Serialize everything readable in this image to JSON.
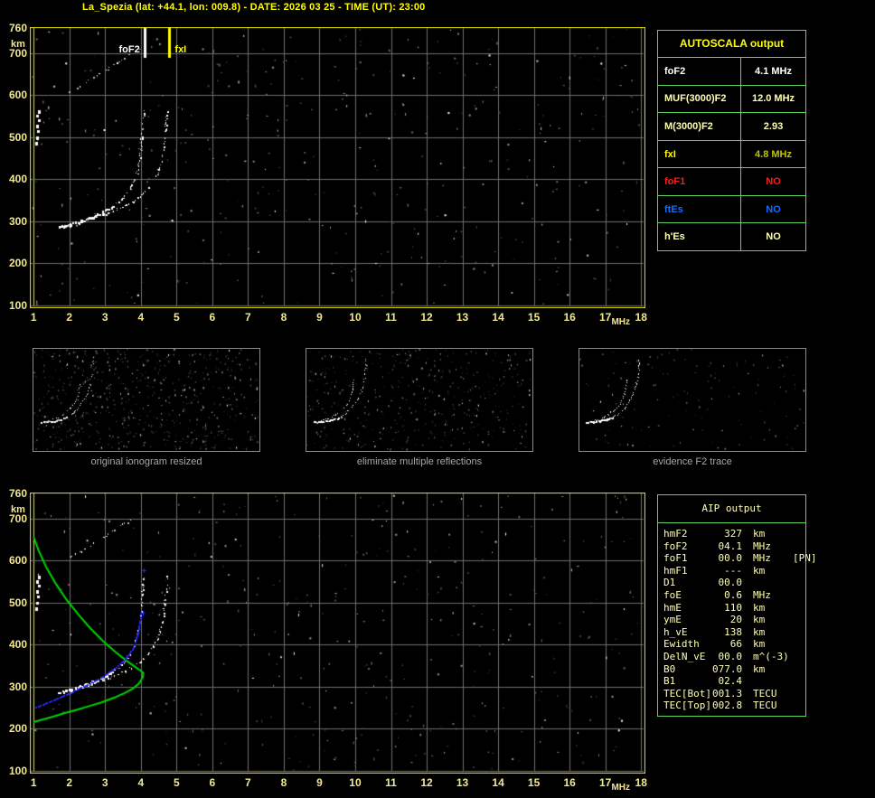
{
  "title": "La_Spezia (lat: +44.1, lon: 009.8) - DATE: 2026 03 25 - TIME (UT): 23:00",
  "palette": {
    "background": "#000000",
    "title_yellow": "#ffff00",
    "axis_label": "#f2e88e",
    "frame_yellow": "#e8e800",
    "grid_gray": "#6f6f6f",
    "table_border_green": "#5ed65e",
    "cream": "#ffffb0",
    "white": "#ffffff",
    "yellow": "#ffff00",
    "dark_yellow": "#c2c200",
    "red": "#ff1a1a",
    "blue": "#1a6aff",
    "caption_gray": "#a8a8a8",
    "profile_green": "#00d400",
    "trace_blue": "#2828ff"
  },
  "autoscala_table": {
    "title": "AUTOSCALA output",
    "rows": [
      {
        "label": "foF2",
        "value": "4.1 MHz",
        "label_color": "white",
        "value_color": "white"
      },
      {
        "label": "MUF(3000)F2",
        "value": "12.0 MHz",
        "label_color": "cream",
        "value_color": "cream"
      },
      {
        "label": "M(3000)F2",
        "value": "2.93",
        "label_color": "cream",
        "value_color": "cream"
      },
      {
        "label": "fxI",
        "value": "4.8 MHz",
        "label_color": "yellow",
        "value_color": "dark_yellow"
      },
      {
        "label": "foF1",
        "value": "NO",
        "label_color": "red",
        "value_color": "red"
      },
      {
        "label": "ftEs",
        "value": "NO",
        "label_color": "blue",
        "value_color": "blue"
      },
      {
        "label": "h'Es",
        "value": "NO",
        "label_color": "cream",
        "value_color": "cream"
      }
    ]
  },
  "aip_table": {
    "title": "AIP output",
    "rows": [
      {
        "label": "hmF2",
        "value": "327",
        "unit": "km",
        "note": ""
      },
      {
        "label": "foF2",
        "value": "04.1",
        "unit": "MHz",
        "note": ""
      },
      {
        "label": "foF1",
        "value": "00.0",
        "unit": "MHz",
        "note": "[PN]"
      },
      {
        "label": "hmF1",
        "value": "---",
        "unit": "km",
        "note": ""
      },
      {
        "label": "D1",
        "value": "00.0",
        "unit": "",
        "note": ""
      },
      {
        "label": "foE",
        "value": "0.6",
        "unit": "MHz",
        "note": ""
      },
      {
        "label": "hmE",
        "value": "110",
        "unit": "km",
        "note": ""
      },
      {
        "label": "ymE",
        "value": "20",
        "unit": "km",
        "note": ""
      },
      {
        "label": "h_vE",
        "value": "138",
        "unit": "km",
        "note": ""
      },
      {
        "label": "Ewidth",
        "value": "66",
        "unit": "km",
        "note": ""
      },
      {
        "label": "DelN_vE",
        "value": "00.0",
        "unit": "m^(-3)",
        "note": ""
      },
      {
        "label": "B0",
        "value": "077.0",
        "unit": "km",
        "note": ""
      },
      {
        "label": "B1",
        "value": "02.4",
        "unit": "",
        "note": ""
      },
      {
        "label": "TEC[Bot]",
        "value": "001.3",
        "unit": "TECU",
        "note": ""
      },
      {
        "label": "TEC[Top]",
        "value": "002.8",
        "unit": "TECU",
        "note": ""
      }
    ]
  },
  "thumbnails": [
    {
      "caption": "original ionogram resized"
    },
    {
      "caption": "eliminate multiple reflections"
    },
    {
      "caption": "evidence F2 trace"
    }
  ],
  "chart_data": [
    {
      "type": "scatter",
      "name": "scaled-ionogram",
      "xlabel": "MHz",
      "ylabel": "km",
      "xlim": [
        1,
        18
      ],
      "ylim": [
        100,
        760
      ],
      "x_ticks": [
        1,
        2,
        3,
        4,
        5,
        6,
        7,
        8,
        9,
        10,
        11,
        12,
        13,
        14,
        15,
        16,
        17,
        18
      ],
      "y_ticks": [
        760,
        700,
        600,
        500,
        400,
        300,
        200,
        100
      ],
      "grid": true,
      "markers": [
        {
          "label": "foF2",
          "freq_mhz": 4.1,
          "color": "#ffffff"
        },
        {
          "label": "fxI",
          "freq_mhz": 4.8,
          "color": "#ffff00"
        }
      ],
      "series": [
        {
          "name": "F2-ordinary-trace",
          "color": "#ffffff",
          "points": [
            [
              1.7,
              288
            ],
            [
              1.85,
              291
            ],
            [
              2.0,
              294
            ],
            [
              2.15,
              298
            ],
            [
              2.3,
              302
            ],
            [
              2.45,
              306
            ],
            [
              2.6,
              311
            ],
            [
              2.75,
              316
            ],
            [
              2.9,
              322
            ],
            [
              3.05,
              329
            ],
            [
              3.2,
              337
            ],
            [
              3.35,
              347
            ],
            [
              3.5,
              358
            ],
            [
              3.62,
              370
            ],
            [
              3.72,
              383
            ],
            [
              3.8,
              397
            ],
            [
              3.87,
              413
            ],
            [
              3.92,
              431
            ],
            [
              3.96,
              451
            ],
            [
              3.99,
              473
            ],
            [
              4.02,
              497
            ],
            [
              4.04,
              522
            ],
            [
              4.05,
              545
            ],
            [
              4.06,
              562
            ]
          ]
        },
        {
          "name": "F2-extraordinary-trace",
          "color": "#ffffff",
          "points": [
            [
              2.55,
              309
            ],
            [
              2.75,
              313
            ],
            [
              2.95,
              318
            ],
            [
              3.15,
              324
            ],
            [
              3.35,
              330
            ],
            [
              3.55,
              338
            ],
            [
              3.75,
              347
            ],
            [
              3.92,
              357
            ],
            [
              4.08,
              368
            ],
            [
              4.22,
              381
            ],
            [
              4.34,
              396
            ],
            [
              4.44,
              413
            ],
            [
              4.52,
              432
            ],
            [
              4.58,
              453
            ],
            [
              4.63,
              477
            ],
            [
              4.66,
              502
            ],
            [
              4.69,
              528
            ],
            [
              4.71,
              552
            ],
            [
              4.72,
              565
            ]
          ]
        },
        {
          "name": "second-hop-echoes",
          "color": "#cccccc",
          "points": [
            [
              1.78,
              597
            ],
            [
              2.0,
              608
            ],
            [
              2.22,
              619
            ],
            [
              2.44,
              630
            ],
            [
              2.66,
              642
            ],
            [
              2.88,
              654
            ],
            [
              3.1,
              666
            ],
            [
              3.3,
              677
            ],
            [
              3.5,
              689
            ],
            [
              3.68,
              699
            ]
          ]
        },
        {
          "name": "low-frequency-echo-column",
          "color": "#ffffff",
          "points": [
            [
              1.05,
              490
            ],
            [
              1.07,
              503
            ],
            [
              1.1,
              516
            ],
            [
              1.07,
              529
            ],
            [
              1.11,
              542
            ],
            [
              1.06,
              554
            ],
            [
              1.12,
              564
            ]
          ]
        }
      ]
    },
    {
      "type": "scatter+line",
      "name": "ionogram-with-aip-profile",
      "xlabel": "MHz",
      "ylabel": "km",
      "xlim": [
        1,
        18
      ],
      "ylim": [
        100,
        760
      ],
      "x_ticks": [
        1,
        2,
        3,
        4,
        5,
        6,
        7,
        8,
        9,
        10,
        11,
        12,
        13,
        14,
        15,
        16,
        17,
        18
      ],
      "y_ticks": [
        760,
        700,
        600,
        500,
        400,
        300,
        200,
        100
      ],
      "grid": true,
      "series": [
        {
          "name": "electron-density-profile",
          "color": "#00d400",
          "points": [
            [
              1.0,
              656
            ],
            [
              1.15,
              622
            ],
            [
              1.35,
              585
            ],
            [
              1.6,
              548
            ],
            [
              1.9,
              510
            ],
            [
              2.25,
              472
            ],
            [
              2.6,
              438
            ],
            [
              2.95,
              408
            ],
            [
              3.3,
              382
            ],
            [
              3.6,
              362
            ],
            [
              3.85,
              347
            ],
            [
              4.0,
              338
            ],
            [
              4.07,
              333
            ],
            [
              4.05,
              322
            ],
            [
              3.95,
              308
            ],
            [
              3.78,
              296
            ],
            [
              3.55,
              285
            ],
            [
              3.25,
              274
            ],
            [
              2.9,
              263
            ],
            [
              2.55,
              254
            ],
            [
              2.2,
              245
            ],
            [
              1.85,
              237
            ],
            [
              1.5,
              228
            ],
            [
              1.2,
              221
            ],
            [
              1.0,
              216
            ]
          ]
        },
        {
          "name": "restored-trace-fit",
          "color": "#2828ff",
          "points": [
            [
              1.05,
              252
            ],
            [
              1.3,
              261
            ],
            [
              1.6,
              272
            ],
            [
              1.9,
              283
            ],
            [
              2.2,
              295
            ],
            [
              2.5,
              307
            ],
            [
              2.8,
              320
            ],
            [
              3.05,
              333
            ],
            [
              3.3,
              348
            ],
            [
              3.5,
              363
            ],
            [
              3.65,
              378
            ],
            [
              3.77,
              395
            ],
            [
              3.85,
              413
            ],
            [
              3.91,
              432
            ],
            [
              3.95,
              452
            ],
            [
              3.98,
              468
            ],
            [
              4.0,
              480
            ]
          ]
        },
        {
          "name": "restored-trace-outliers",
          "color": "#2828ff",
          "points": [
            [
              4.06,
              476
            ],
            [
              4.09,
              577
            ]
          ]
        }
      ]
    },
    {
      "type": "scatter",
      "name": "processing-thumbnails",
      "note": "three mini renderings of the same ionogram trace",
      "trace_arcs": {
        "outer": [
          [
            0.262,
            0.08
          ],
          [
            0.262,
            0.16
          ],
          [
            0.258,
            0.25
          ],
          [
            0.25,
            0.34
          ],
          [
            0.238,
            0.43
          ],
          [
            0.22,
            0.51
          ],
          [
            0.198,
            0.58
          ],
          [
            0.172,
            0.63
          ],
          [
            0.142,
            0.67
          ],
          [
            0.11,
            0.695
          ],
          [
            0.075,
            0.71
          ],
          [
            0.045,
            0.715
          ]
        ],
        "inner": [
          [
            0.208,
            0.3
          ],
          [
            0.204,
            0.38
          ],
          [
            0.194,
            0.46
          ],
          [
            0.178,
            0.53
          ],
          [
            0.156,
            0.59
          ],
          [
            0.128,
            0.64
          ],
          [
            0.098,
            0.675
          ],
          [
            0.065,
            0.7
          ]
        ],
        "base": [
          [
            0.03,
            0.715
          ],
          [
            0.06,
            0.71
          ],
          [
            0.09,
            0.7
          ],
          [
            0.12,
            0.685
          ],
          [
            0.15,
            0.665
          ]
        ]
      }
    }
  ]
}
